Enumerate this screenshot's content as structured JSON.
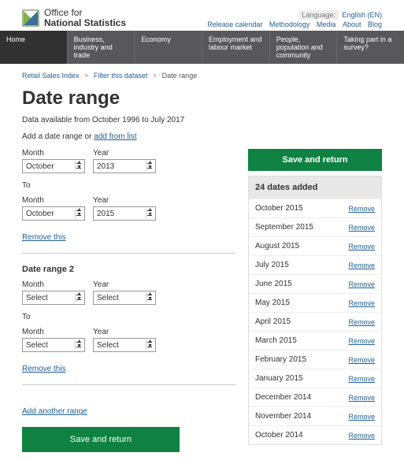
{
  "header": {
    "logo_line1": "Office for",
    "logo_line2": "National Statistics",
    "language_label": "Language:",
    "language_value": "English (EN)",
    "top_links": [
      "Release calendar",
      "Methodology",
      "Media",
      "About",
      "Blog"
    ]
  },
  "nav": [
    {
      "label": "Home",
      "active": true
    },
    {
      "label": "Business, industry and trade"
    },
    {
      "label": "Economy"
    },
    {
      "label": "Employment and labour market"
    },
    {
      "label": "People, population and community"
    },
    {
      "label": "Taking part in a survey?"
    }
  ],
  "breadcrumb": {
    "items": [
      "Retail Sales Index",
      "Filter this dataset"
    ],
    "current": "Date range"
  },
  "page": {
    "title": "Date range",
    "subtitle": "Data available from October 1996 to July 2017",
    "hint_prefix": "Add a date range or ",
    "hint_link": "add from list"
  },
  "form": {
    "month_label": "Month",
    "year_label": "Year",
    "to_label": "To",
    "remove_label": "Remove this",
    "range1": {
      "from_month": "October",
      "from_year": "2013",
      "to_month": "October",
      "to_year": "2015"
    },
    "range2_title": "Date range 2",
    "range2": {
      "from_month": "Select",
      "from_year": "Select",
      "to_month": "Select",
      "to_year": "Select"
    },
    "add_another": "Add another range",
    "save_label": "Save and return"
  },
  "sidebar": {
    "save_label": "Save and return",
    "count_label": "24 dates added",
    "remove_label": "Remove",
    "items": [
      "October 2015",
      "September 2015",
      "August 2015",
      "July 2015",
      "June 2015",
      "May 2015",
      "April 2015",
      "March 2015",
      "February 2015",
      "January 2015",
      "December 2014",
      "November 2014",
      "October 2014"
    ]
  }
}
